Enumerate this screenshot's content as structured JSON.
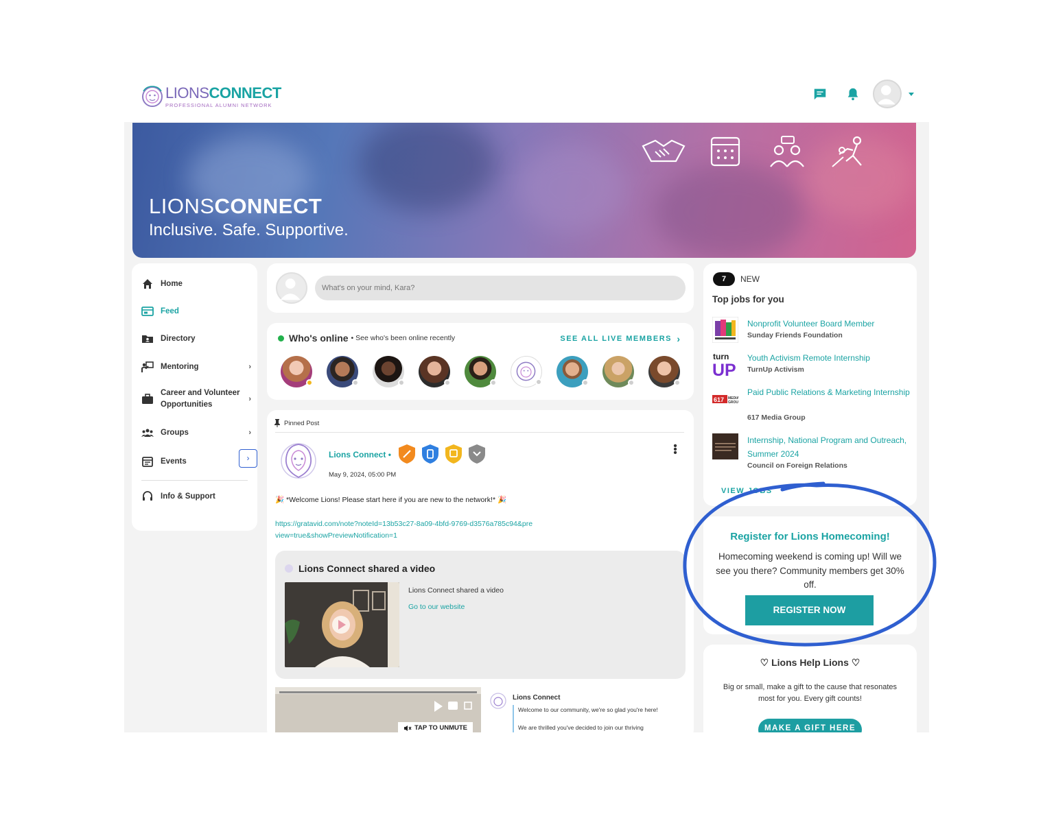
{
  "header": {
    "logo_light": "LIONS",
    "logo_bold": "CONNECT",
    "logo_sub": "PROFESSIONAL ALUMNI NETWORK"
  },
  "banner": {
    "title_light": "LIONS",
    "title_bold": "CONNECT",
    "tagline": "Inclusive. Safe. Supportive."
  },
  "sidebar": {
    "items": [
      {
        "label": "Home",
        "icon": "home-icon"
      },
      {
        "label": "Feed",
        "icon": "feed-icon"
      },
      {
        "label": "Directory",
        "icon": "directory-icon"
      },
      {
        "label": "Mentoring",
        "icon": "mentoring-icon"
      },
      {
        "label": "Career and Volunteer Opportunities",
        "icon": "briefcase-icon"
      },
      {
        "label": "Groups",
        "icon": "groups-icon"
      },
      {
        "label": "Events",
        "icon": "calendar-icon"
      },
      {
        "label": "Info & Support",
        "icon": "support-icon"
      }
    ],
    "chevron": "›",
    "collapse": "›"
  },
  "composer": {
    "placeholder": "What's on your mind, Kara?"
  },
  "online": {
    "title": "Who's online",
    "subtitle": "• See who's been online recently",
    "see_all": "SEE ALL LIVE MEMBERS",
    "see_all_chev": "›",
    "status_colors": [
      "#f2b61e",
      "#cfcfcf",
      "#cfcfcf",
      "#cfcfcf",
      "#cfcfcf",
      "#cfcfcf",
      "#cfcfcf",
      "#cfcfcf",
      "#cfcfcf"
    ]
  },
  "post": {
    "pinned": "Pinned Post",
    "author": "Lions Connect",
    "author_sep": "•",
    "date": "May 9, 2024, 05:00 PM",
    "body": "🎉 *Welcome Lions!  Please start here if you are new to the network!* 🎉",
    "link": "https://gratavid.com/note?noteId=13b53c27-8a09-4bfd-9769-d3576a785c94&preview=true&showPreviewNotification=1",
    "shared_title": "Lions Connect shared a video",
    "shared_desc": "Lions Connect shared a video",
    "shared_link": "Go to our website",
    "tap_unmute": "TAP TO UNMUTE",
    "mini_author": "Lions Connect",
    "mini_text_1": "Welcome to our community, we're so glad you're here!",
    "mini_text_2": "We are thrilled you've decided to join our thriving"
  },
  "jobs": {
    "count": "7",
    "new_label": "NEW",
    "title": "Top jobs for you",
    "items": [
      {
        "title": "Nonprofit Volunteer Board Member",
        "company": "Sunday Friends Foundation"
      },
      {
        "title": "Youth Activism Remote Internship",
        "company": "TurnUp Activism"
      },
      {
        "title": "Paid Public Relations & Marketing Internship",
        "company": "617 Media Group"
      },
      {
        "title": "Internship, National Program and Outreach, Summer 2024",
        "company": "Council on Foreign Relations"
      }
    ],
    "view_jobs": "VIEW JOBS"
  },
  "homecoming": {
    "title": "Register for Lions Homecoming!",
    "text": "Homecoming weekend is coming up! Will we see you there? Community members get 30% off.",
    "button": "REGISTER NOW"
  },
  "gift": {
    "title": "♡ Lions Help Lions ♡",
    "text": "Big or small, make a gift to the cause that resonates most for you. Every gift counts!",
    "button": "MAKE A GIFT HERE"
  },
  "colors": {
    "accent": "#1aa3a3",
    "annotation": "#2f5fd0"
  }
}
